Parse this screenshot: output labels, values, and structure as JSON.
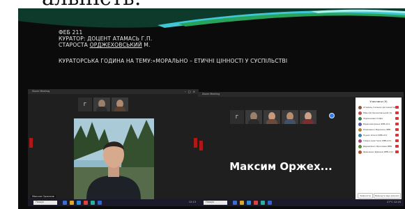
{
  "heading": "альність:",
  "slide": {
    "line1": "ФЕБ 211",
    "line2": "КУРАТОР: ДОЦЕНТ АТАМАСЬ Г.П.",
    "line3_prefix": "СТАРОСТА ",
    "line3_underlined": "ОРДЖЕХОВСЬКИЙ",
    "line3_suffix": " М.",
    "line4": "КУРАТОРСЬКА ГОДИНА НА ТЕМУ:«МОРАЛЬНО – ЕТИЧНІ ЦІННОСТІ У СУСПІЛЬСТВІ"
  },
  "left_window": {
    "title": "Zoom Meeting",
    "thumb_initial": "Г",
    "video_name": "Максим Оржехов",
    "taskbar_search": "Пошук",
    "clock": "12:13"
  },
  "right_window": {
    "title": "Zoom Meeting",
    "thumb_initial": "Г",
    "speaker_name": "Максим Оржех...",
    "panel_title": "Учасники (9)",
    "participants": [
      {
        "name": "Атамась Галина (організатор)",
        "color": "#8b5a3c"
      },
      {
        "name": "Максим Оржеховський (я)",
        "color": "#c05050"
      },
      {
        "name": "Хаджинова Софія",
        "color": "#3d7a4e"
      },
      {
        "name": "Бірюкова Ірина ФЕБ-211",
        "color": "#5a5a9a"
      },
      {
        "name": "Коваленко Вероніка ФЕБ",
        "color": "#b0803a"
      },
      {
        "name": "Луцик Олеся ФЕБ-211",
        "color": "#3a7fb0"
      },
      {
        "name": "Гмиря Анастасія ФЕБ-211",
        "color": "#9a4a8a"
      },
      {
        "name": "Дерев'янко Ярослава ФЕБ",
        "color": "#5a8a3a"
      },
      {
        "name": "Шевченко Дарина ФЕБ-211",
        "color": "#aa5533"
      }
    ],
    "invite_label": "Запросити",
    "mute_all_label": "Вимкнути звук для всіх",
    "taskbar_search": "Пошук",
    "clock": "27°C 12:20"
  },
  "colors": {
    "slide_bg": "#0b0b0b",
    "accent_cyan": "#3fc7d6",
    "accent_green": "#28a35a",
    "mic_red": "#d33333"
  }
}
